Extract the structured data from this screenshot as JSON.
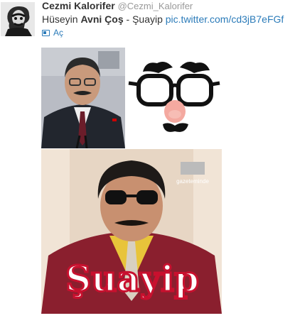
{
  "tweet": {
    "display_name": "Cezmi Kalorifer",
    "handle": "@Cezmi_Kalorifer",
    "text_prefix": "Hüseyin ",
    "text_bold": "Avni Çoş",
    "text_sep": " - Şuayip ",
    "link": "pic.twitter.com/cd3jB7eFGf",
    "expand_label": "Aç"
  },
  "images": {
    "meme_caption": "Şuayip",
    "watermark": "gazeteminde"
  },
  "colors": {
    "link": "#2b7bb9",
    "name": "#333333",
    "handle": "#999999"
  }
}
